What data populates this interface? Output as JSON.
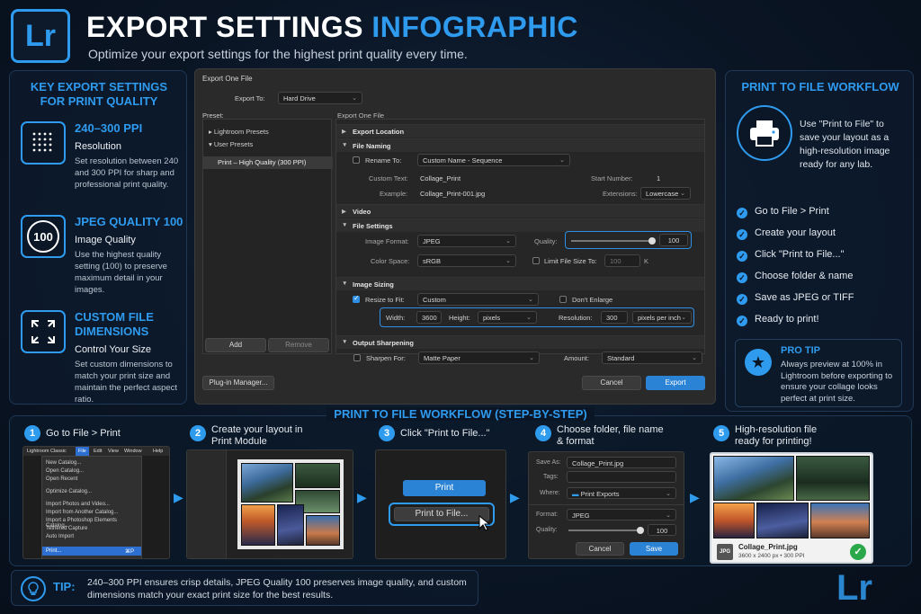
{
  "header": {
    "logo": "Lr",
    "title_part1": "EXPORT SETTINGS",
    "title_part2": "INFOGRAPHIC",
    "subtitle": "Optimize your export settings for the highest print quality every time."
  },
  "key_settings": {
    "heading": "KEY EXPORT SETTINGS FOR PRINT QUALITY",
    "items": [
      {
        "icon": "resolution-grid-icon",
        "title": "240–300 PPI",
        "subtitle": "Resolution",
        "description": "Set resolution between 240 and 300 PPI for sharp and professional print quality."
      },
      {
        "icon": "quality-100-icon",
        "icon_text": "100",
        "title": "JPEG QUALITY 100",
        "subtitle": "Image Quality",
        "description": "Use the highest quality setting (100) to preserve maximum detail in your images."
      },
      {
        "icon": "expand-corners-icon",
        "title": "CUSTOM FILE DIMENSIONS",
        "subtitle": "Control Your Size",
        "description": "Set custom dimensions to match your print size and maintain the perfect aspect ratio."
      }
    ]
  },
  "dialog": {
    "title": "Export One File",
    "export_to_label": "Export To:",
    "export_to_value": "Hard Drive",
    "preset_label": "Preset:",
    "settings_header": "Export One File",
    "presets": [
      "Lightroom Presets",
      "User Presets",
      "Print – High Quality (300 PPI)"
    ],
    "add_label": "Add",
    "remove_label": "Remove",
    "sections": {
      "export_location": "Export Location",
      "file_naming": "File Naming",
      "video": "Video",
      "file_settings": "File Settings",
      "image_sizing": "Image Sizing",
      "output_sharpening": "Output Sharpening"
    },
    "naming": {
      "rename_label": "Rename To:",
      "rename_value": "Custom Name - Sequence",
      "custom_text_label": "Custom Text:",
      "custom_text_value": "Collage_Print",
      "start_number_label": "Start Number:",
      "start_number_value": "1",
      "example_label": "Example:",
      "example_value": "Collage_Print-001.jpg",
      "extensions_label": "Extensions:",
      "extensions_value": "Lowercase"
    },
    "file_settings": {
      "format_label": "Image Format:",
      "format_value": "JPEG",
      "quality_label": "Quality:",
      "quality_value": "100",
      "quality_level": 100,
      "color_space_label": "Color Space:",
      "color_space_value": "sRGB",
      "limit_label": "Limit File Size To:",
      "limit_value": "100",
      "limit_unit": "K"
    },
    "sizing": {
      "resize_label": "Resize to Fit:",
      "resize_value": "Custom",
      "dont_enlarge": "Don't Enlarge",
      "width_label": "Width:",
      "width_value": "3600",
      "height_label": "Height:",
      "height_unit": "pixels",
      "resolution_label": "Resolution:",
      "resolution_value": "300",
      "resolution_unit": "pixels per inch"
    },
    "sharpening": {
      "sharpen_label": "Sharpen For:",
      "sharpen_value": "Matte Paper",
      "amount_label": "Amount:",
      "amount_value": "Standard"
    },
    "plugin_manager": "Plug-in Manager...",
    "cancel": "Cancel",
    "export": "Export"
  },
  "workflow_panel": {
    "heading": "PRINT TO FILE WORKFLOW",
    "intro": "Use \"Print to File\" to save your layout as a high-resolution image ready for any lab.",
    "steps": [
      "Go to File > Print",
      "Create your layout",
      "Click \"Print to File...\"",
      "Choose folder & name",
      "Save as JPEG or TIFF",
      "Ready to print!"
    ],
    "pro_tip_heading": "PRO TIP",
    "pro_tip_text": "Always preview at 100% in Lightroom before exporting to ensure your collage looks perfect at print size."
  },
  "workflow_steps": {
    "heading": "PRINT TO FILE WORKFLOW (STEP-BY-STEP)",
    "steps": [
      {
        "num": "1",
        "label": "Go to File > Print"
      },
      {
        "num": "2",
        "label": "Create your layout in Print Module"
      },
      {
        "num": "3",
        "label": "Click \"Print to File...\""
      },
      {
        "num": "4",
        "label": "Choose folder, file name & format"
      },
      {
        "num": "5",
        "label": "High-resolution file ready for printing!"
      }
    ],
    "menu": {
      "bar": [
        "Lightroom Classic",
        "File",
        "Edit",
        "View",
        "Window",
        "Help"
      ],
      "items": [
        "New Catalog...",
        "Open Catalog...",
        "Open Recent",
        "Optimize Catalog...",
        "Import Photos and Video...",
        "Import from Another Catalog...",
        "Import a Photoshop Elements Catalog...",
        "Tethered Capture",
        "Auto Import",
        "Print...",
        "⌘P"
      ]
    },
    "step3": {
      "print": "Print",
      "print_to_file": "Print to File..."
    },
    "save": {
      "save_as_label": "Save As:",
      "save_as_value": "Collage_Print.jpg",
      "tags_label": "Tags:",
      "where_label": "Where:",
      "where_value": "Print Exports",
      "format_label": "Format:",
      "format_value": "JPEG",
      "quality_label": "Quality:",
      "quality_value": "100",
      "cancel": "Cancel",
      "save": "Save"
    },
    "result": {
      "badge": "JPG",
      "file_name": "Collage_Print.jpg",
      "dims": "3600 x 2400 px",
      "sep": "•",
      "ppi": "300 PPI"
    }
  },
  "tip": {
    "label": "TIP:",
    "text": "240–300 PPI ensures crisp details, JPEG Quality 100 preserves image quality, and custom dimensions match your exact print size for the best results."
  },
  "footer_logo": "Lr"
}
